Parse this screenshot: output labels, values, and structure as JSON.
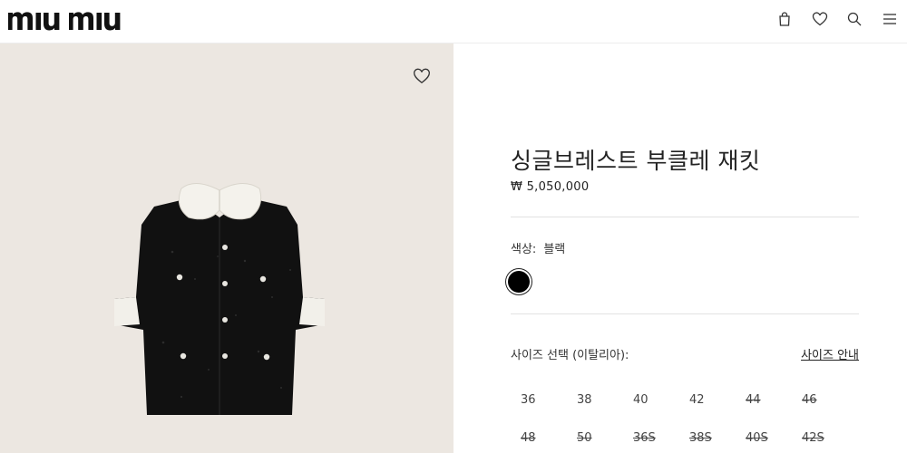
{
  "header": {
    "logo_text": "MIU MIU",
    "icons": [
      "bag-icon",
      "heart-icon",
      "search-icon",
      "menu-icon"
    ]
  },
  "product": {
    "title": "싱글브레스트 부클레 재킷",
    "price": "₩ 5,050,000",
    "color_label": "색상:",
    "color_value": "블랙",
    "swatch_color": "#000000",
    "size_label": "사이즈 선택 (이탈리아):",
    "size_guide": "사이즈 안내",
    "sizes": [
      {
        "label": "36",
        "available": true
      },
      {
        "label": "38",
        "available": true
      },
      {
        "label": "40",
        "available": true
      },
      {
        "label": "42",
        "available": true
      },
      {
        "label": "44",
        "available": false
      },
      {
        "label": "46",
        "available": false
      },
      {
        "label": "48",
        "available": false
      },
      {
        "label": "50",
        "available": false
      },
      {
        "label": "36S",
        "available": false
      },
      {
        "label": "38S",
        "available": false
      },
      {
        "label": "40S",
        "available": false
      },
      {
        "label": "42S",
        "available": false
      }
    ]
  },
  "image": {
    "background_color": "#ece7e1",
    "subject": "black short-sleeve boucle jacket with white collar"
  }
}
